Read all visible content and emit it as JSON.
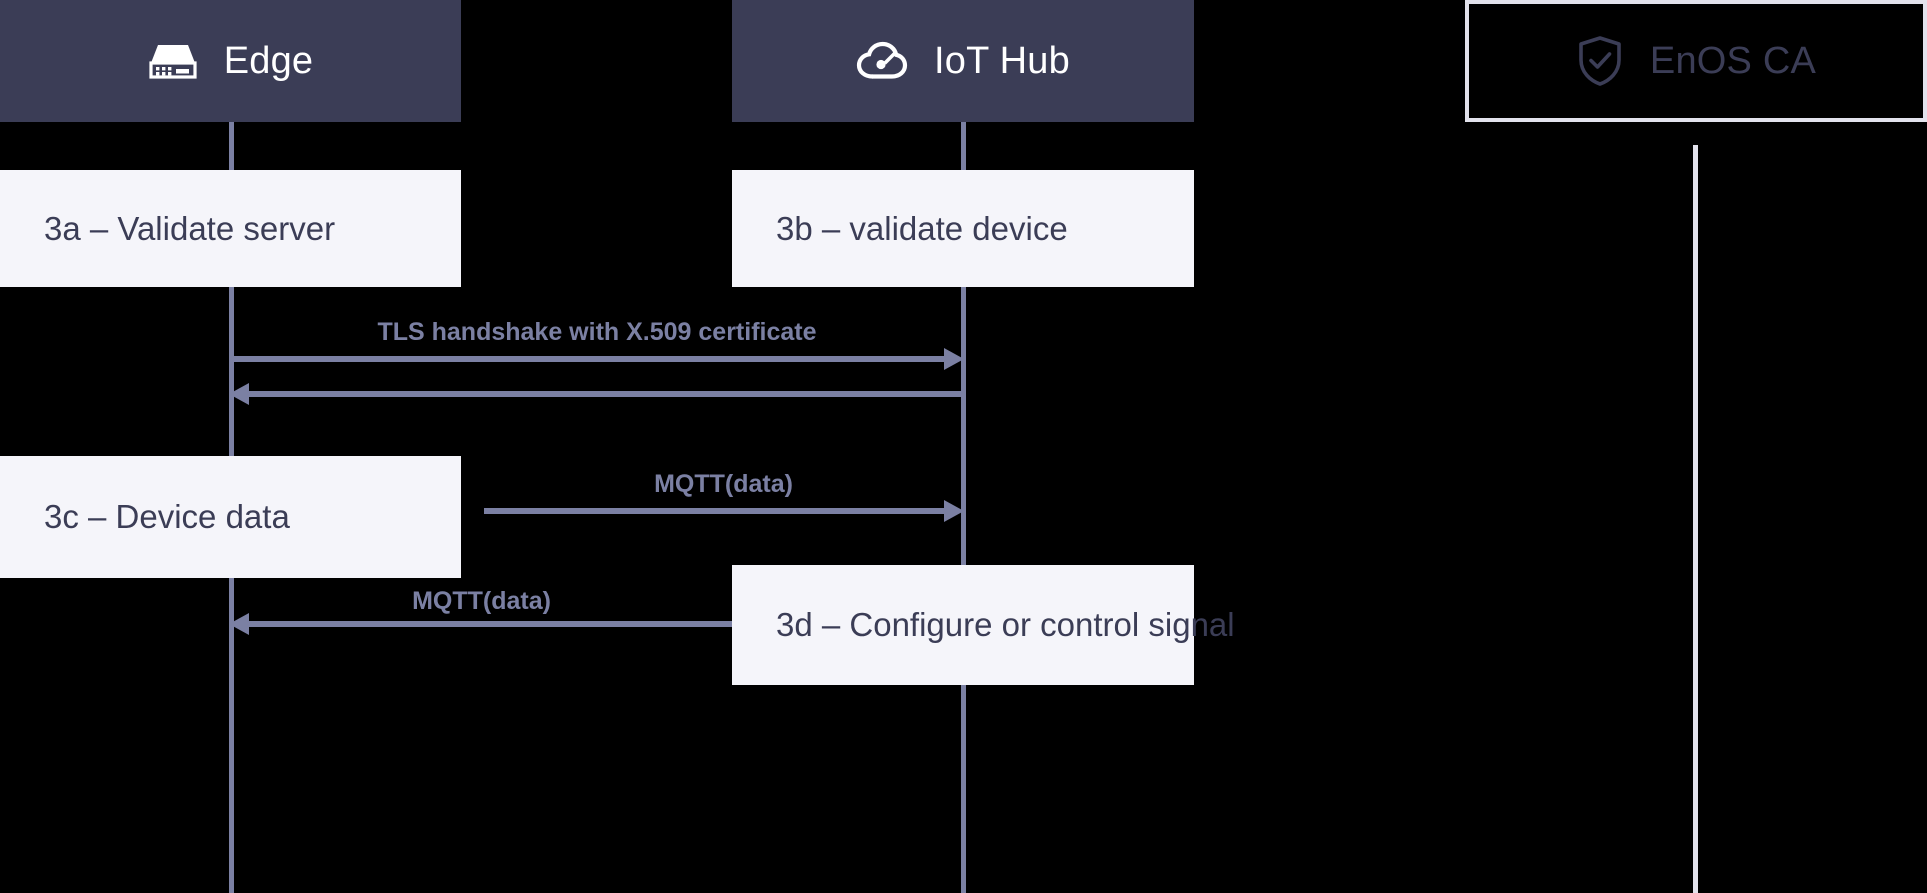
{
  "diagram": {
    "type": "sequence-diagram",
    "background_color": "#000000",
    "accent_header_color": "#3b3d56",
    "note_fill_color": "#f5f5fa",
    "message_color": "#7b80a3",
    "ca_lifeline_color": "#e2e2ec"
  },
  "participants": [
    {
      "id": "edge",
      "label": "Edge",
      "icon": "edge-gateway-icon",
      "style": "solid"
    },
    {
      "id": "iot_hub",
      "label": "IoT Hub",
      "icon": "cloud-gauge-icon",
      "style": "solid"
    },
    {
      "id": "enos_ca",
      "label": "EnOS CA",
      "icon": "shield-check-icon",
      "style": "outlined"
    }
  ],
  "notes": [
    {
      "id": "note_3a",
      "label": "3a – Validate server",
      "on": "edge"
    },
    {
      "id": "note_3b",
      "label": "3b – validate device",
      "on": "iot_hub"
    },
    {
      "id": "note_3c",
      "label": "3c – Device data",
      "on": "edge"
    },
    {
      "id": "note_3d",
      "label": "3d – Configure or control signal",
      "on": "iot_hub"
    }
  ],
  "messages": [
    {
      "id": "msg_tls_request",
      "label": "TLS handshake with X.509 certificate",
      "from": "edge",
      "to": "iot_hub",
      "direction": "right"
    },
    {
      "id": "msg_tls_response",
      "label": "",
      "from": "iot_hub",
      "to": "edge",
      "direction": "left"
    },
    {
      "id": "msg_mqtt_up",
      "label": "MQTT(data)",
      "from": "edge",
      "to": "iot_hub",
      "direction": "right"
    },
    {
      "id": "msg_mqtt_down",
      "label": "MQTT(data)",
      "from": "iot_hub",
      "to": "edge",
      "direction": "left"
    }
  ]
}
